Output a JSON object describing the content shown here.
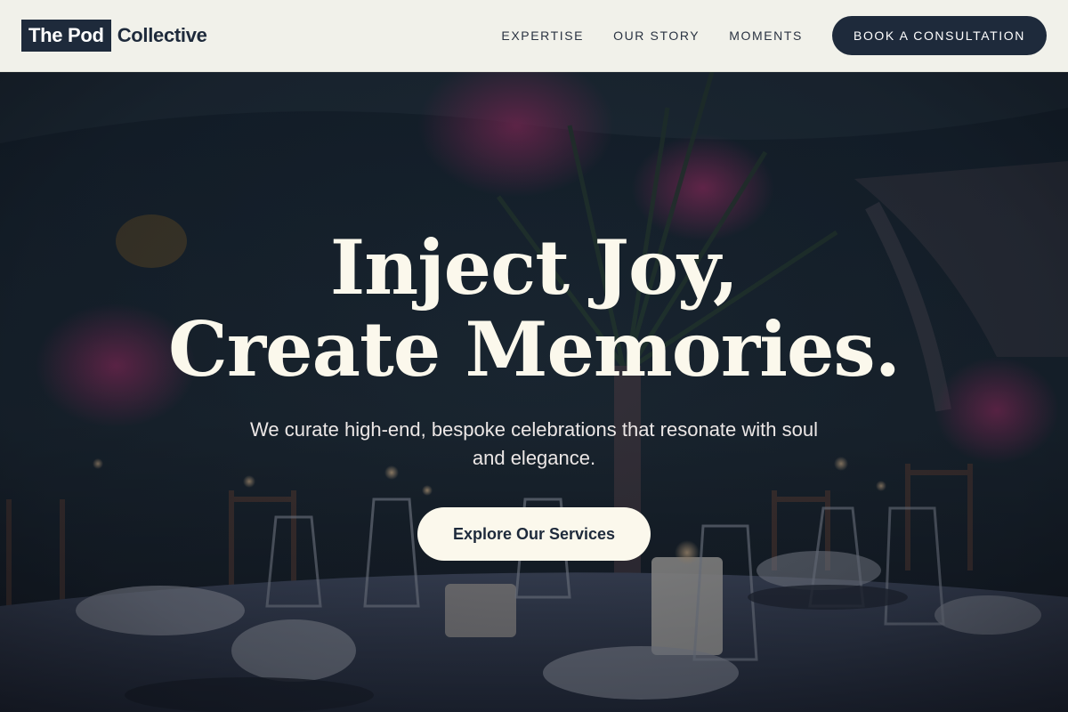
{
  "header": {
    "logo_box": "The Pod",
    "logo_rest": "Collective",
    "nav": [
      {
        "label": "EXPERTISE"
      },
      {
        "label": "OUR STORY"
      },
      {
        "label": "MOMENTS"
      }
    ],
    "cta_label": "BOOK A CONSULTATION"
  },
  "hero": {
    "title_line1": "Inject Joy,",
    "title_line2": "Create Memories.",
    "subtitle": "We curate high-end, bespoke celebrations that resonate with soul and elegance.",
    "button_label": "Explore Our Services"
  },
  "colors": {
    "brand_navy": "#1e2a3b",
    "header_bg": "#f1f1ea",
    "cream": "#fbf8ec"
  }
}
